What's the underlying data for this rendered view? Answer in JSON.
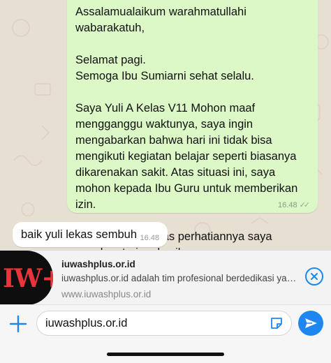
{
  "chat": {
    "outgoing": {
      "paragraphs": [
        "Assalamualaikum warahmatullahi wabarakatuh,",
        "Selamat pagi.\nSemoga Ibu Sumiarni sehat selalu.",
        "Saya Yuli A Kelas V11 Mohon maaf mengganggu waktunya, saya ingin mengabarkan bahwa hari ini tidak bisa mengikuti kegiatan belajar seperti biasanya dikarenakan sakit. Atas situasi ini, saya mohon kepada Ibu Guru untuk memberikan izin.",
        "Demikian, Ibu. Atas perhatiannya saya ucapkan terima kasih."
      ],
      "time": "16.48",
      "status_icon": "double-check-icon"
    },
    "incoming": {
      "text": "baik yuli lekas sembuh",
      "time": "16.48"
    }
  },
  "link_preview": {
    "thumbnail_text": "IW+",
    "title": "iuwashplus.or.id",
    "description": "iuwashplus.or.id adalah tim profesional berdedikasi yang...",
    "url": "www.iuwashplus.or.id",
    "close_icon": "close-circle-icon"
  },
  "composer": {
    "value": "iuwashplus.or.id",
    "attach_icon": "plus-icon",
    "sticker_icon": "sticker-icon",
    "send_icon": "send-icon"
  },
  "colors": {
    "outgoing_bubble": "#dcf8c6",
    "incoming_bubble": "#ffffff",
    "accent": "#1e86f0",
    "chat_background": "#e8dfd3"
  }
}
